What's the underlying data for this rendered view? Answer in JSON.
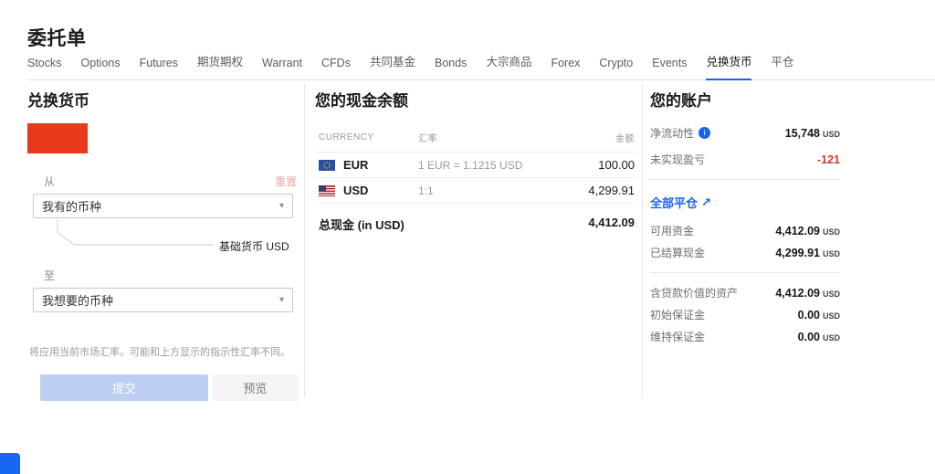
{
  "page": {
    "title": "委托单"
  },
  "colors": {
    "accent_blue": "#1b62f0",
    "negative_red": "#d6372c",
    "placeholder_red": "#e8391d",
    "submit_disabled_blue": "#bccff3"
  },
  "icons": {
    "chevron_down": "▾",
    "info": "i",
    "external_arrow": "↗"
  },
  "tabs": [
    {
      "label": "Stocks",
      "active": false
    },
    {
      "label": "Options",
      "active": false
    },
    {
      "label": "Futures",
      "active": false
    },
    {
      "label": "期货期权",
      "active": false
    },
    {
      "label": "Warrant",
      "active": false
    },
    {
      "label": "CFDs",
      "active": false
    },
    {
      "label": "共同基金",
      "active": false
    },
    {
      "label": "Bonds",
      "active": false
    },
    {
      "label": "大宗商品",
      "active": false
    },
    {
      "label": "Forex",
      "active": false
    },
    {
      "label": "Crypto",
      "active": false
    },
    {
      "label": "Events",
      "active": false
    },
    {
      "label": "兑换货币",
      "active": true
    },
    {
      "label": "平仓",
      "active": false
    }
  ],
  "exchange": {
    "title": "兑换货币",
    "from_label": "从",
    "reset_label": "重置",
    "from_value": "我有的币种",
    "base_currency_label": "基础货币 USD",
    "to_label": "至",
    "to_value": "我想要的币种",
    "note": "将应用当前市场汇率。可能和上方显示的指示性汇率不同。",
    "submit_label": "提交",
    "preview_label": "预览"
  },
  "cash": {
    "title": "您的现金余额",
    "columns": {
      "currency": "CURRENCY",
      "rate": "汇率",
      "amount": "金额"
    },
    "rows": [
      {
        "flag": "eu-flag",
        "currency": "EUR",
        "rate": "1 EUR  =  1.1215 USD",
        "amount": "100.00"
      },
      {
        "flag": "us-flag",
        "currency": "USD",
        "rate": "1:1",
        "amount": "4,299.91"
      }
    ],
    "total_label": "总现金 (in USD)",
    "total_amount": "4,412.09"
  },
  "account": {
    "title": "您的账户",
    "stats": [
      {
        "label": "净流动性",
        "value": "15,748",
        "unit": "USD"
      },
      {
        "label": "未实现盈亏",
        "value": "-121",
        "unit": ""
      }
    ],
    "close_all_label": "全部平仓",
    "funds": [
      {
        "label": "可用资金",
        "value": "4,412.09",
        "unit": "USD"
      },
      {
        "label": "已结算现金",
        "value": "4,299.91",
        "unit": "USD"
      }
    ],
    "margin": [
      {
        "label": "含贷款价值的资产",
        "value": "4,412.09",
        "unit": "USD"
      },
      {
        "label": "初始保证金",
        "value": "0.00",
        "unit": "USD"
      },
      {
        "label": "维持保证金",
        "value": "0.00",
        "unit": "USD"
      }
    ]
  }
}
